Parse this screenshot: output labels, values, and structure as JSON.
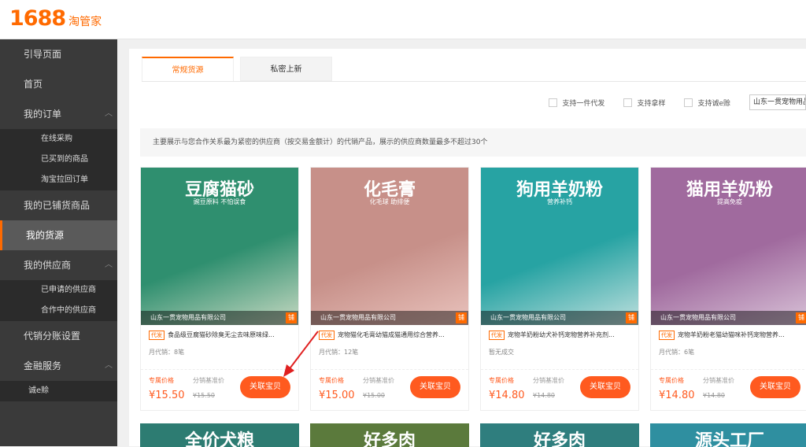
{
  "logo": {
    "number": "1688",
    "text": "淘管家"
  },
  "sidebar": {
    "items": [
      {
        "label": "引导页面"
      },
      {
        "label": "首页"
      },
      {
        "label": "我的订单"
      },
      {
        "label": "我的已铺货商品"
      },
      {
        "label": "我的货源"
      },
      {
        "label": "我的供应商"
      },
      {
        "label": "代销分账设置"
      },
      {
        "label": "金融服务"
      }
    ],
    "orders_sub": [
      "在线采购",
      "已买到的商品",
      "淘宝拉回订单"
    ],
    "suppliers_sub": [
      "已申请的供应商",
      "合作中的供应商"
    ],
    "finance_sub": [
      "诚e赊"
    ]
  },
  "tabs": [
    {
      "label": "常规货源"
    },
    {
      "label": "私密上新"
    }
  ],
  "filters": {
    "one_piece": "支持一件代发",
    "sample": "支持拿样",
    "credit": "支持诚e赊",
    "supplier_selected": "山东一贯宠物用品"
  },
  "notice": "主要展示与您合作关系最为紧密的供应商（按交易金额计）的代销产品，展示的供应商数量最多不超过30个",
  "cards": [
    {
      "img_title": "豆腐猫砂",
      "img_sub": "豌豆原料 不怕误食",
      "strip": "山东一贯宠物用品有限公司",
      "strip_tag": "铺",
      "badge": "代发",
      "title": "食品级豆腐猫砂除臭无尘去味原味绿...",
      "sales": "月代销：8笔",
      "price_label": "专属价格",
      "price": "¥15.50",
      "base_label": "分销基准价",
      "base": "¥15.50",
      "button": "关联宝贝",
      "bg": "#2f8f6f",
      "bg2": "#c7d9c2"
    },
    {
      "img_title": "化毛膏",
      "img_sub": "化毛球 助排便",
      "strip": "山东一贯宠物用品有限公司",
      "strip_tag": "铺",
      "badge": "代发",
      "title": "宠物猫化毛膏幼猫成猫通用综合营养...",
      "sales": "月代销：12笔",
      "price_label": "专属价格",
      "price": "¥15.00",
      "base_label": "分销基准价",
      "base": "¥15.00",
      "button": "关联宝贝",
      "bg": "#c79089",
      "bg2": "#e9c3bd"
    },
    {
      "img_title": "狗用羊奶粉",
      "img_sub": "营养补钙",
      "strip": "山东一贯宠物用品有限公司",
      "strip_tag": "铺",
      "badge": "代发",
      "title": "宠物羊奶粉幼犬补钙宠物营养补充剂...",
      "sales": "暂无成交",
      "price_label": "专属价格",
      "price": "¥14.80",
      "base_label": "分销基准价",
      "base": "¥14.80",
      "button": "关联宝贝",
      "bg": "#27a3a3",
      "bg2": "#bfe0de"
    },
    {
      "img_title": "猫用羊奶粉",
      "img_sub": "提高免疫",
      "strip": "山东一贯宠物用品有限公司",
      "strip_tag": "铺",
      "badge": "代发",
      "title": "宠物羊奶粉老猫幼猫咪补钙宠物营养...",
      "sales": "月代销：6笔",
      "price_label": "专属价格",
      "price": "¥14.80",
      "base_label": "分销基准价",
      "base": "¥14.80",
      "button": "关联宝贝",
      "bg": "#a06a9e",
      "bg2": "#d9c3d8"
    }
  ],
  "row2": [
    {
      "text": "全价犬粮",
      "bg": "#2d7c72"
    },
    {
      "text": "好多肉",
      "bg": "#5b7a3c"
    },
    {
      "text": "好多肉",
      "bg": "#2f7e7e"
    },
    {
      "text": "源头工厂",
      "bg": "#2f8fa0"
    }
  ],
  "colors": {
    "accent": "#ff6a00",
    "price": "#ff5a1f"
  }
}
